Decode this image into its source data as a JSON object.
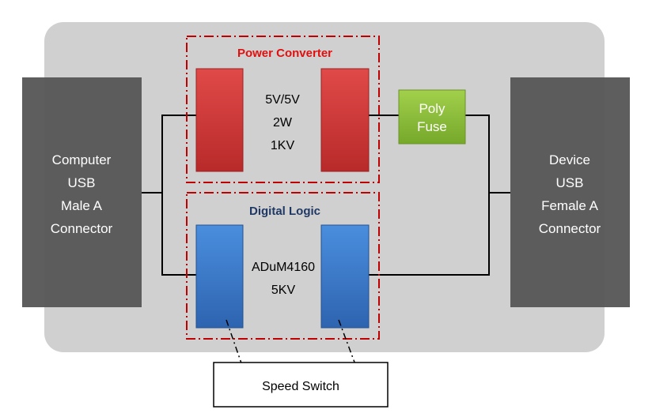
{
  "colors": {
    "background_panel": "#d0d0d0",
    "connector": "#555555",
    "power_block": "#d94141",
    "logic_block": "#3f7fd0",
    "fuse": "#8cbf3a",
    "group_border": "#c00000",
    "power_title": "#e01010",
    "logic_title": "#1f3864"
  },
  "left_connector": {
    "lines": [
      "Computer",
      "USB",
      "Male A",
      "Connector"
    ]
  },
  "right_connector": {
    "lines": [
      "Device",
      "USB",
      "Female A",
      "Connector"
    ]
  },
  "power_group": {
    "title": "Power Converter",
    "specs": [
      "5V/5V",
      "2W",
      "1KV"
    ]
  },
  "logic_group": {
    "title": "Digital Logic",
    "specs": [
      "ADuM4160",
      "5KV"
    ]
  },
  "fuse": {
    "lines": [
      "Poly",
      "Fuse"
    ]
  },
  "speed_switch": {
    "label": "Speed Switch"
  }
}
